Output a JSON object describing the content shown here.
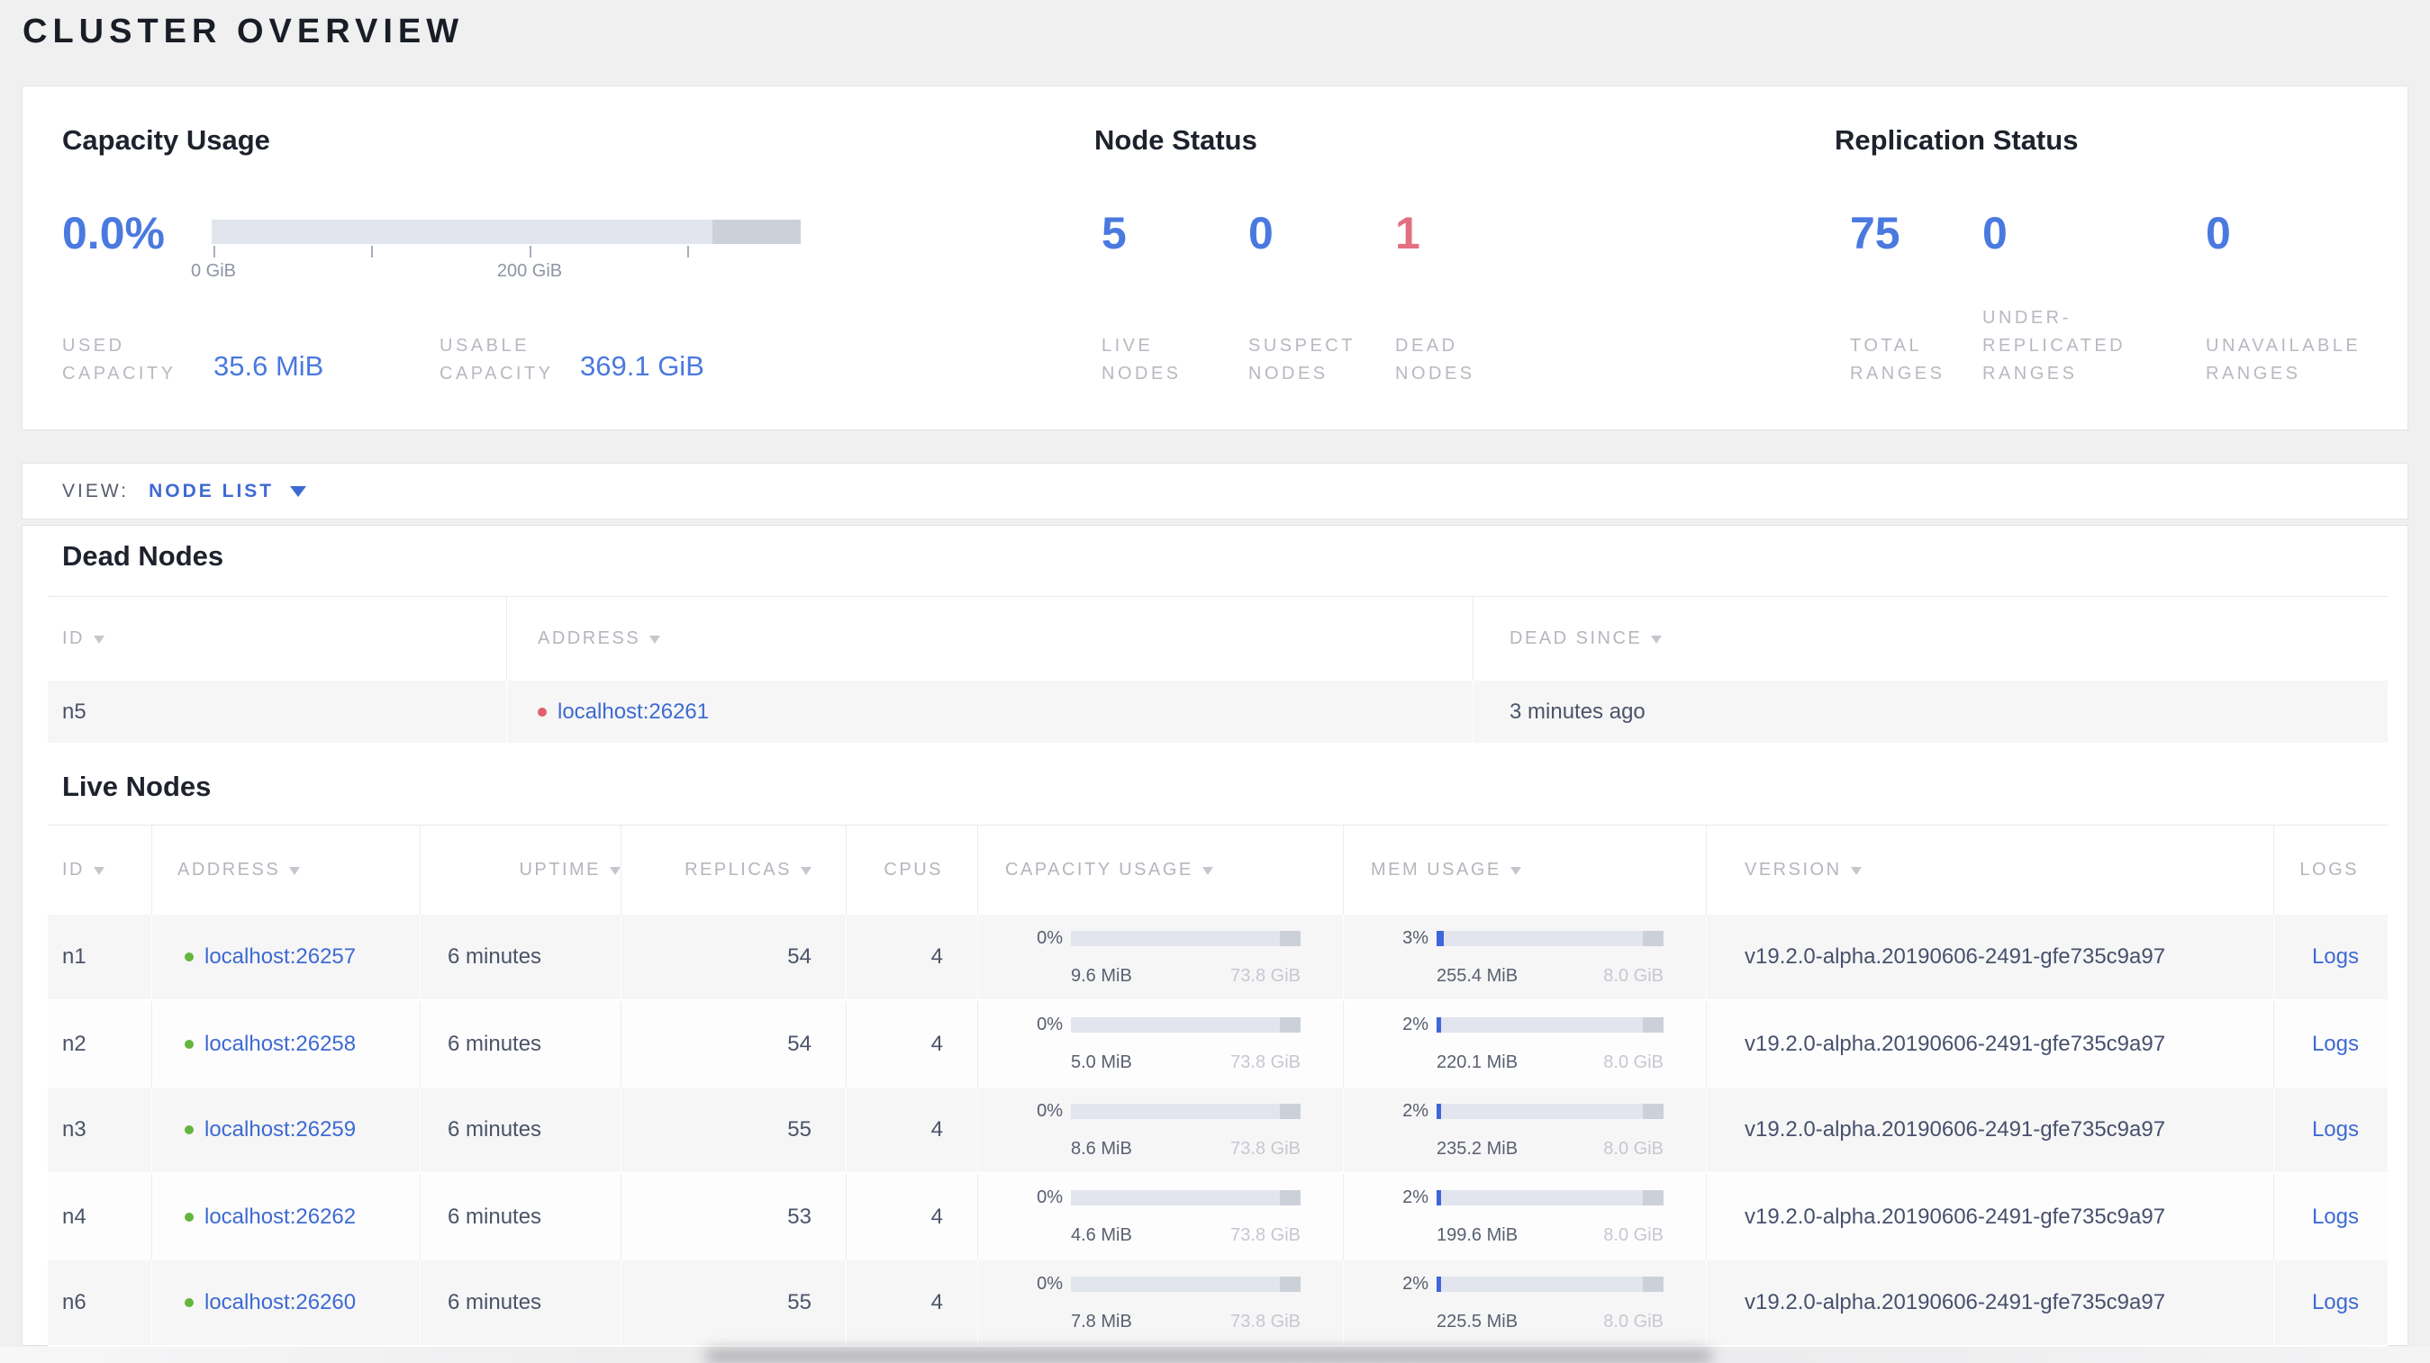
{
  "page": {
    "title": "CLUSTER OVERVIEW"
  },
  "colors": {
    "accent_blue": "#4a79df",
    "link_blue": "#3e6ad2",
    "danger_red": "#e36f80",
    "live_green_dot": "#64b53e",
    "dead_red_dot": "#e25f6e",
    "bar_track": "#e3e5ee",
    "bar_dark_segment": "#ccd0d9",
    "bar_blue_fill": "#3d66d8"
  },
  "summary": {
    "capacity": {
      "title": "Capacity Usage",
      "percent": "0.0%",
      "tick_label_0": "0 GiB",
      "tick_label_200": "200 GiB",
      "used_label": "USED\nCAPACITY",
      "used_value": "35.6 MiB",
      "usable_label": "USABLE\nCAPACITY",
      "usable_value": "369.1 GiB"
    },
    "node_status": {
      "title": "Node Status",
      "live": {
        "value": "5",
        "label": "LIVE\nNODES"
      },
      "suspect": {
        "value": "0",
        "label": "SUSPECT\nNODES"
      },
      "dead": {
        "value": "1",
        "label": "DEAD\nNODES"
      }
    },
    "replication": {
      "title": "Replication Status",
      "total": {
        "value": "75",
        "label": "TOTAL\nRANGES"
      },
      "under": {
        "value": "0",
        "label": "UNDER-\nREPLICATED\nRANGES"
      },
      "unavailable": {
        "value": "0",
        "label": "UNAVAILABLE\nRANGES"
      }
    }
  },
  "view_bar": {
    "label": "VIEW:",
    "selected": "NODE LIST"
  },
  "dead_nodes": {
    "title": "Dead Nodes",
    "headers": [
      "ID",
      "ADDRESS",
      "DEAD SINCE"
    ],
    "rows": [
      {
        "id": "n5",
        "address": "localhost:26261",
        "dead_since": "3 minutes ago"
      }
    ]
  },
  "live_nodes": {
    "title": "Live Nodes",
    "headers": [
      "ID",
      "ADDRESS",
      "UPTIME",
      "REPLICAS",
      "CPUS",
      "CAPACITY USAGE",
      "MEM USAGE",
      "VERSION",
      "LOGS"
    ],
    "rows": [
      {
        "id": "n1",
        "address": "localhost:26257",
        "uptime": "6 minutes",
        "replicas": "54",
        "cpus": "4",
        "capacity": {
          "pct": "0%",
          "fill": "0%",
          "used": "9.6 MiB",
          "total": "73.8 GiB"
        },
        "mem": {
          "pct": "3%",
          "fill": "3%",
          "used": "255.4 MiB",
          "total": "8.0 GiB"
        },
        "version": "v19.2.0-alpha.20190606-2491-gfe735c9a97",
        "logs_label": "Logs"
      },
      {
        "id": "n2",
        "address": "localhost:26258",
        "uptime": "6 minutes",
        "replicas": "54",
        "cpus": "4",
        "capacity": {
          "pct": "0%",
          "fill": "0%",
          "used": "5.0 MiB",
          "total": "73.8 GiB"
        },
        "mem": {
          "pct": "2%",
          "fill": "2%",
          "used": "220.1 MiB",
          "total": "8.0 GiB"
        },
        "version": "v19.2.0-alpha.20190606-2491-gfe735c9a97",
        "logs_label": "Logs"
      },
      {
        "id": "n3",
        "address": "localhost:26259",
        "uptime": "6 minutes",
        "replicas": "55",
        "cpus": "4",
        "capacity": {
          "pct": "0%",
          "fill": "0%",
          "used": "8.6 MiB",
          "total": "73.8 GiB"
        },
        "mem": {
          "pct": "2%",
          "fill": "2%",
          "used": "235.2 MiB",
          "total": "8.0 GiB"
        },
        "version": "v19.2.0-alpha.20190606-2491-gfe735c9a97",
        "logs_label": "Logs"
      },
      {
        "id": "n4",
        "address": "localhost:26262",
        "uptime": "6 minutes",
        "replicas": "53",
        "cpus": "4",
        "capacity": {
          "pct": "0%",
          "fill": "0%",
          "used": "4.6 MiB",
          "total": "73.8 GiB"
        },
        "mem": {
          "pct": "2%",
          "fill": "2%",
          "used": "199.6 MiB",
          "total": "8.0 GiB"
        },
        "version": "v19.2.0-alpha.20190606-2491-gfe735c9a97",
        "logs_label": "Logs"
      },
      {
        "id": "n6",
        "address": "localhost:26260",
        "uptime": "6 minutes",
        "replicas": "55",
        "cpus": "4",
        "capacity": {
          "pct": "0%",
          "fill": "0%",
          "used": "7.8 MiB",
          "total": "73.8 GiB"
        },
        "mem": {
          "pct": "2%",
          "fill": "2%",
          "used": "225.5 MiB",
          "total": "8.0 GiB"
        },
        "version": "v19.2.0-alpha.20190606-2491-gfe735c9a97",
        "logs_label": "Logs"
      }
    ]
  }
}
